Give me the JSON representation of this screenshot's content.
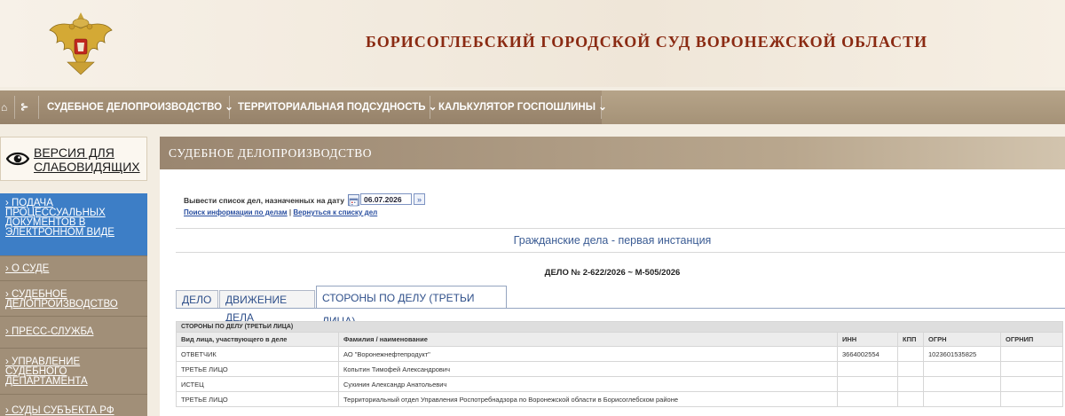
{
  "header": {
    "title": "БОРИСОГЛЕБСКИЙ ГОРОДСКОЙ СУД ВОРОНЕЖСКОЙ ОБЛАСТИ"
  },
  "nav": {
    "home_icon": "home-icon",
    "sitemap_icon": "sitemap-icon",
    "items": [
      {
        "label": "СУДЕБНОЕ ДЕЛОПРОИЗВОДСТВО ⌄"
      },
      {
        "label": "ТЕРРИТОРИАЛЬНАЯ ПОДСУДНОСТЬ ⌄"
      },
      {
        "label": "КАЛЬКУЛЯТОР ГОСПОШЛИНЫ ⌄"
      }
    ]
  },
  "sidebar": {
    "vision_line1": "ВЕРСИЯ ДЛЯ",
    "vision_line2": "СЛАБОВИДЯЩИХ",
    "items": [
      {
        "lines": [
          "› ПОДАЧА",
          "ПРОЦЕССУАЛЬНЫХ",
          "ДОКУМЕНТОВ В",
          "ЭЛЕКТРОННОМ ВИДЕ"
        ]
      },
      {
        "lines": [
          "› О СУДЕ"
        ]
      },
      {
        "lines": [
          "› СУДЕБНОЕ",
          "ДЕЛОПРОИЗВОДСТВО"
        ]
      },
      {
        "lines": [
          "› ПРЕСС-СЛУЖБА"
        ]
      },
      {
        "lines": [
          "› УПРАВЛЕНИЕ",
          "СУДЕБНОГО",
          "ДЕПАРТАМЕНТА"
        ]
      },
      {
        "lines": [
          "› СУДЫ СУБЪЕКТА РФ"
        ]
      }
    ]
  },
  "main": {
    "section_title": "СУДЕБНОЕ ДЕЛОПРОИЗВОДСТВО",
    "date_label": "Вывести список дел, назначенных на дату",
    "date_value": "06.07.2026",
    "go_symbol": "»",
    "link_search": "Поиск информации по делам",
    "link_sep": " | ",
    "link_back": "Вернуться к списку дел",
    "case_type": "Гражданские дела - первая инстанция",
    "case_number": "ДЕЛО № 2-622/2026 ~ М-505/2026",
    "tabs": [
      {
        "label": "ДЕЛО"
      },
      {
        "label": "ДВИЖЕНИЕ ДЕЛА"
      },
      {
        "label": "СТОРОНЫ ПО ДЕЛУ (ТРЕТЬИ ЛИЦА)"
      }
    ],
    "table": {
      "caption": "СТОРОНЫ ПО ДЕЛУ (ТРЕТЬИ ЛИЦА)",
      "columns": [
        "Вид лица, участвующего в деле",
        "Фамилия / наименование",
        "ИНН",
        "КПП",
        "ОГРН",
        "ОГРНИП"
      ],
      "rows": [
        [
          "ОТВЕТЧИК",
          "АО \"Воронежнефтепродукт\"",
          "3664002554",
          "",
          "1023601535825",
          ""
        ],
        [
          "ТРЕТЬЕ ЛИЦО",
          "Копытин Тимофей Александрович",
          "",
          "",
          "",
          ""
        ],
        [
          "ИСТЕЦ",
          "Сухинин Александр Анатольевич",
          "",
          "",
          "",
          ""
        ],
        [
          "ТРЕТЬЕ ЛИЦО",
          "Территориальный отдел Управления Роспотребнадзора по Воронежской области в Борисоглебском районе",
          "",
          "",
          "",
          ""
        ]
      ]
    }
  }
}
